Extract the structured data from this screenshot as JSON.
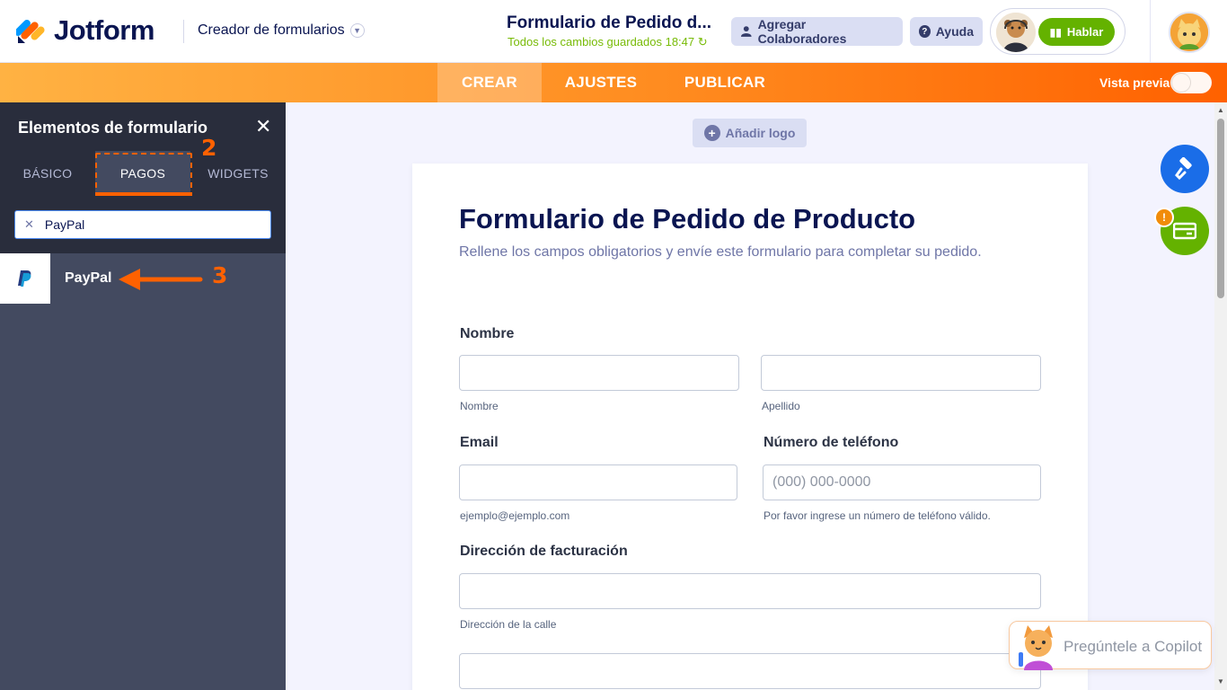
{
  "header": {
    "logo_text": "Jotform",
    "app_menu_label": "Creador de formularios",
    "form_title": "Formulario de Pedido d...",
    "save_status": "Todos los cambios guardados 18:47",
    "collaborators_label": "Agregar Colaboradores",
    "help_label": "Ayuda",
    "talk_label": "Hablar"
  },
  "nav": {
    "tabs": [
      "CREAR",
      "AJUSTES",
      "PUBLICAR"
    ],
    "active_tab": "CREAR",
    "preview_label": "Vista previa",
    "preview_enabled": false
  },
  "panel": {
    "title": "Elementos de formulario",
    "tabs": [
      "BÁSICO",
      "PAGOS",
      "WIDGETS"
    ],
    "active_tab": "PAGOS",
    "search_value": "PayPal",
    "results": [
      {
        "label": "PayPal",
        "icon": "paypal-icon"
      }
    ],
    "annotations": [
      "2",
      "3"
    ]
  },
  "form": {
    "add_logo_label": "Añadir logo",
    "title": "Formulario de Pedido de Producto",
    "subtitle": "Rellene los campos obligatorios y envíe este formulario para completar su pedido.",
    "fields": {
      "name_label": "Nombre",
      "first_name_hint": "Nombre",
      "last_name_hint": "Apellido",
      "email_label": "Email",
      "email_hint": "ejemplo@ejemplo.com",
      "phone_label": "Número de teléfono",
      "phone_placeholder": "(000) 000-0000",
      "phone_hint": "Por favor ingrese un número de teléfono válido.",
      "address_label": "Dirección de facturación",
      "street_hint": "Dirección de la calle"
    }
  },
  "side": {
    "badge": "!"
  },
  "copilot": {
    "label": "Pregúntele a Copilot"
  },
  "colors": {
    "brand_orange": "#ff6100",
    "navy": "#0a1551",
    "saved_green": "#78bb07",
    "talk_green": "#64b200",
    "fab_blue": "#1a6de8",
    "fab_green": "#64b200"
  }
}
